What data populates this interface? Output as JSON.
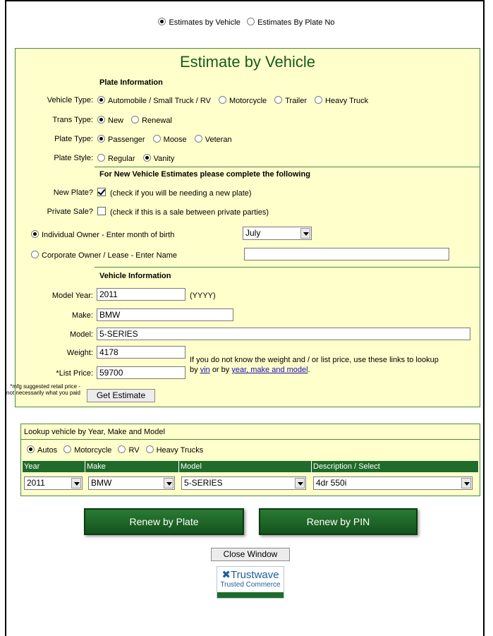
{
  "mode": {
    "by_vehicle": "Estimates by Vehicle",
    "by_plate": "Estimates By Plate No"
  },
  "estimate": {
    "title": "Estimate by Vehicle",
    "plate_header": "Plate Information",
    "vehicle_type_label": "Vehicle Type:",
    "vehicle_types": [
      "Automobile / Small Truck / RV",
      "Motorcycle",
      "Trailer",
      "Heavy Truck"
    ],
    "trans_type_label": "Trans Type:",
    "trans_types": [
      "New",
      "Renewal"
    ],
    "plate_type_label": "Plate Type:",
    "plate_types": [
      "Passenger",
      "Moose",
      "Veteran"
    ],
    "plate_style_label": "Plate Style:",
    "plate_styles": [
      "Regular",
      "Vanity"
    ],
    "new_header": "For New Vehicle Estimates please complete the following",
    "new_plate_label": "New Plate?",
    "new_plate_note": "(check if you will be needing a new plate)",
    "private_sale_label": "Private Sale?",
    "private_sale_note": "(check if this is a sale between private parties)",
    "individual_owner": "Individual Owner - Enter month of birth",
    "birth_month": "July",
    "corporate_owner": "Corporate Owner / Lease - Enter Name",
    "vehicle_header": "Vehicle Information",
    "model_year_label": "Model Year:",
    "model_year": "2011",
    "year_hint": "(YYYY)",
    "make_label": "Make:",
    "make": "BMW",
    "model_label": "Model:",
    "model": "5-SERIES",
    "weight_label": "Weight:",
    "weight": "4178",
    "list_price_label": "*List Price:",
    "list_price": "59700",
    "lookup_note": "If you do not know the weight and / or list price, use these links to lookup",
    "by_text": "by",
    "or_by_text": "or by",
    "vin_link": "vin",
    "ymm_link": "year, make and model",
    "period": ".",
    "msrp_note": "*mfg suggested retail price - not necessarily what you paid",
    "get_estimate": "Get Estimate"
  },
  "lookup": {
    "title": "Lookup vehicle by Year, Make and Model",
    "types": [
      "Autos",
      "Motorcycle",
      "RV",
      "Heavy Trucks"
    ],
    "columns": [
      "Year",
      "Make",
      "Model",
      "Description / Select"
    ],
    "year": "2011",
    "make": "BMW",
    "model": "5-SERIES",
    "description": "4dr 550i"
  },
  "actions": {
    "renew_plate": "Renew by Plate",
    "renew_pin": "Renew by PIN",
    "close": "Close Window"
  },
  "trustwave": {
    "brand": "Trustwave",
    "tagline": "Trusted Commerce"
  },
  "colors": {
    "panel_bg": "#ffffcc",
    "accent_green": "#1f6b2b",
    "title_green": "#155a1c"
  }
}
